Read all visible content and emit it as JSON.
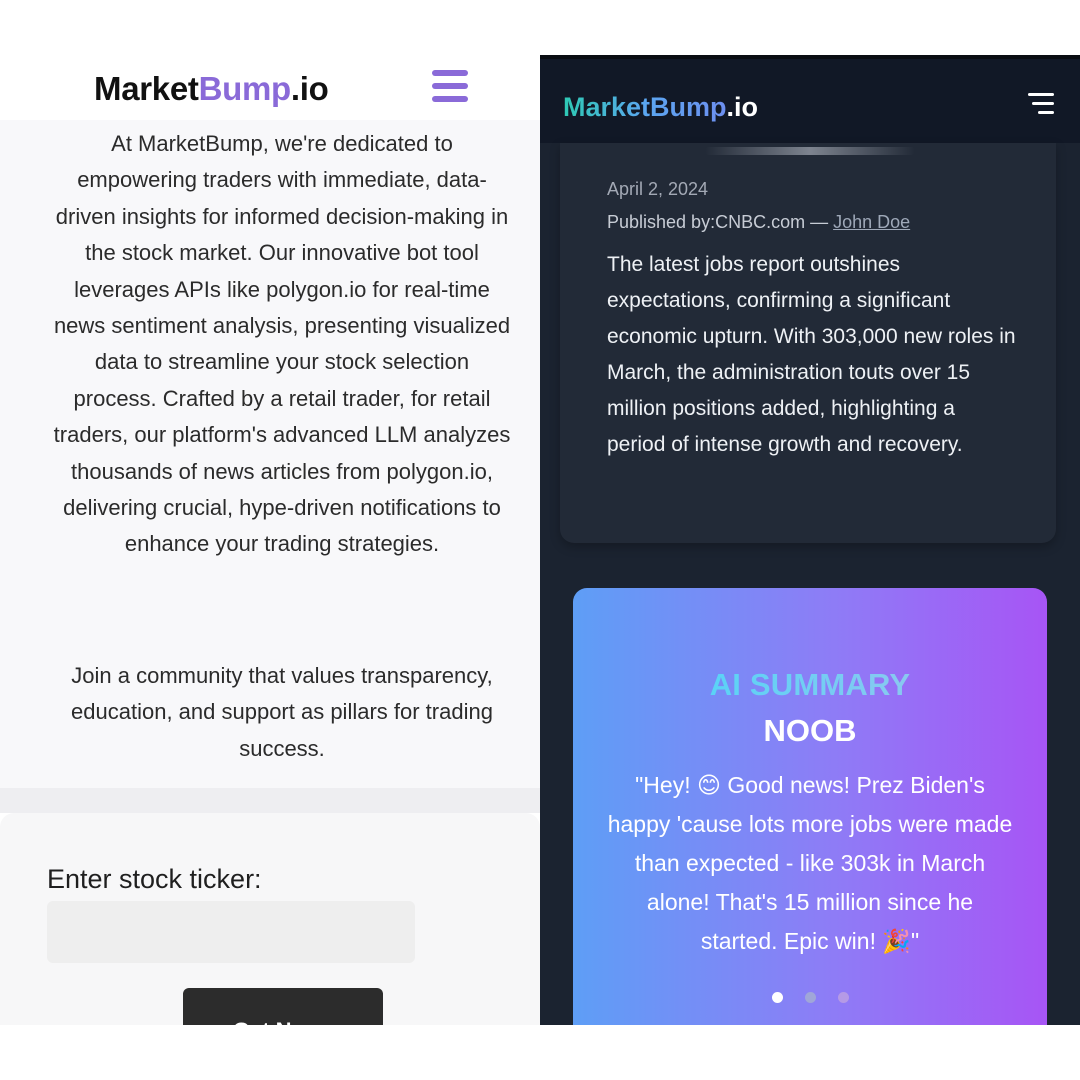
{
  "left": {
    "logo": {
      "part1": "Market",
      "part2": "Bump",
      "part3": ".io"
    },
    "about_text": "At MarketBump, we're dedicated to empowering traders with immediate, data-driven insights for informed decision-making in the stock market. Our innovative bot tool leverages APIs like polygon.io for real-time news sentiment analysis, presenting visualized data to streamline your stock selection process. Crafted by a retail trader, for retail traders, our platform's advanced LLM analyzes thousands of news articles from polygon.io, delivering crucial, hype-driven notifications to enhance your trading strategies.",
    "community_text": "Join a community that values transparency, education, and support as pillars for trading success.",
    "ticker_label": "Enter stock ticker:",
    "ticker_value": "",
    "get_news_label": "Get News",
    "colors": {
      "brand_purple": "#8a6ad8"
    },
    "icons": {
      "menu": "hamburger-menu-icon"
    }
  },
  "right": {
    "logo": {
      "brand": "MarketBump",
      "suffix": ".io"
    },
    "article": {
      "date": "April 2, 2024",
      "published_prefix": "Published by:CNBC.com — ",
      "author": "John Doe",
      "body": "The latest jobs report outshines expectations, confirming a significant economic upturn. With 303,000 new roles in March, the administration touts over 15 million positions added, highlighting a period of intense growth and recovery."
    },
    "summary": {
      "title": "AI SUMMARY",
      "level": "NOOB",
      "quote": "\"Hey! 😊 Good news! Prez Biden's happy 'cause lots more jobs were made than expected - like 303k in March alone! That's 15 million since he started. Epic win! 🎉\"",
      "pagination_total": 3,
      "pagination_active": 1
    },
    "colors": {
      "background": "#1b2330",
      "card": "#222a37",
      "gradient_start": "#5e9ef6",
      "gradient_end": "#a755f5"
    },
    "icons": {
      "menu": "hamburger-menu-icon"
    }
  }
}
